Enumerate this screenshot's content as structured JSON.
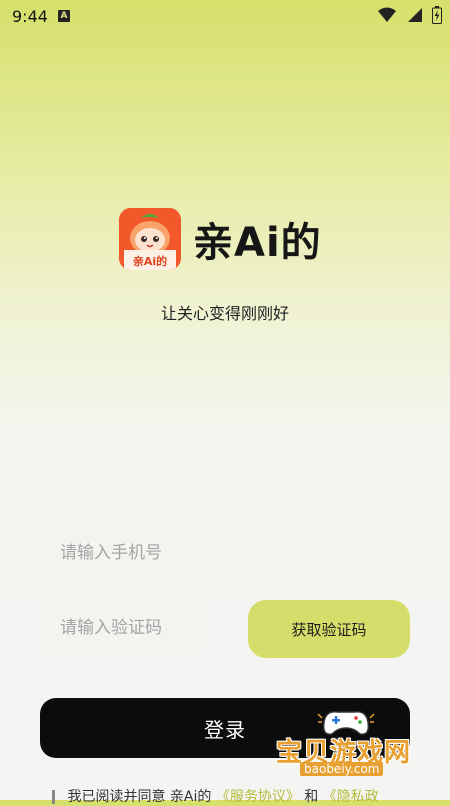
{
  "status_bar": {
    "time": "9:44",
    "badge": "A",
    "icons": [
      "wifi-icon",
      "signal-icon",
      "battery-icon"
    ]
  },
  "brand": {
    "name": "亲Ai的",
    "icon_label": "亲Ai的",
    "slogan": "让关心变得刚刚好"
  },
  "login_form": {
    "phone_placeholder": "请输入手机号",
    "code_placeholder": "请输入验证码",
    "get_code_label": "获取验证码",
    "login_label": "登录"
  },
  "agreement": {
    "prefix": "我已阅读并同意 亲Ai的",
    "service_link": "《服务协议》",
    "conjunction": "和",
    "privacy_link": "《隐私政"
  },
  "watermark": {
    "title": "宝贝游戏网",
    "url": "baobeiy.com"
  },
  "colors": {
    "accent": "#d6de6b",
    "button_dark": "#0c0c0c",
    "icon_orange": "#f25d2b",
    "link": "#b5bd3a"
  }
}
